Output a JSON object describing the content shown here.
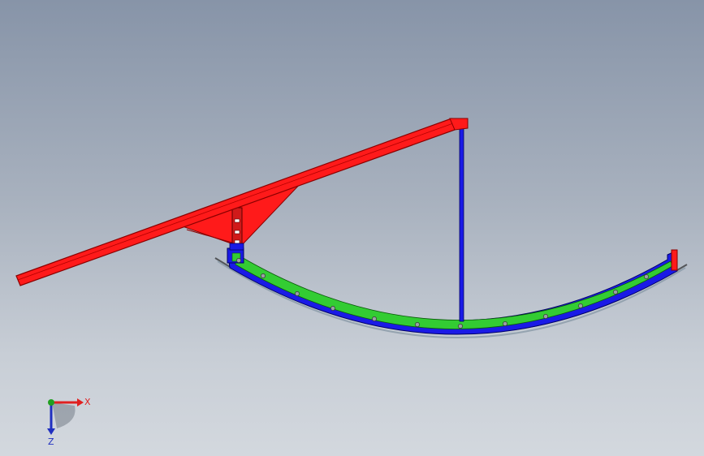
{
  "colors": {
    "beam": "#ff1a1a",
    "beam_edge": "#8a0000",
    "frame": "#1a1ae6",
    "frame_edge": "#000066",
    "infill": "#33cc33",
    "bolt": "#9aa0a6",
    "axis_x": "#e02020",
    "axis_y": "#20a020",
    "axis_z": "#2030c0"
  },
  "triad": {
    "x_label": "X",
    "z_label": "Z"
  },
  "icons": [
    "triad-icon"
  ]
}
